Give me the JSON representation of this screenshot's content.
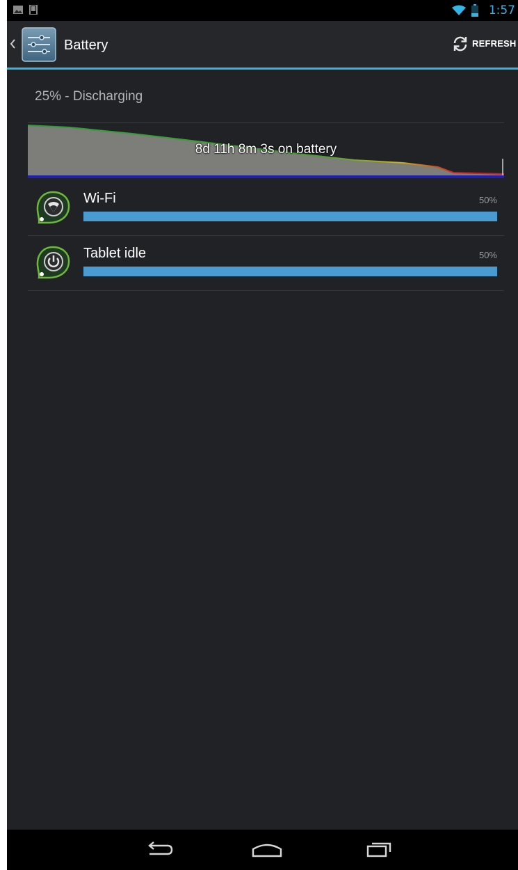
{
  "status_bar": {
    "time": "1:57",
    "left_icons": [
      "gallery-notification-icon",
      "screenshot-notification-icon"
    ],
    "right_icons": [
      "wifi-icon",
      "battery-icon"
    ]
  },
  "action_bar": {
    "title": "Battery",
    "refresh_label": "REFRESH",
    "accent_color": "#33b5e5"
  },
  "summary": {
    "status_text": "25% - Discharging",
    "graph_label": "8d 11h 8m 3s on battery"
  },
  "usage": [
    {
      "label": "Wi-Fi",
      "percent_text": "50%",
      "percent": 50,
      "icon": "wifi-app-icon"
    },
    {
      "label": "Tablet idle",
      "percent_text": "50%",
      "percent": 50,
      "icon": "power-app-icon"
    }
  ],
  "colors": {
    "background": "#202226",
    "bar": "#4a9bd2",
    "graph_fill": "#7d7e79",
    "graph_line_start": "#2f9a3a",
    "graph_line_end": "#d02020",
    "graph_baseline": "#2020b0"
  },
  "nav_bar": {
    "buttons": [
      "back-icon",
      "home-icon",
      "recent-apps-icon"
    ]
  }
}
